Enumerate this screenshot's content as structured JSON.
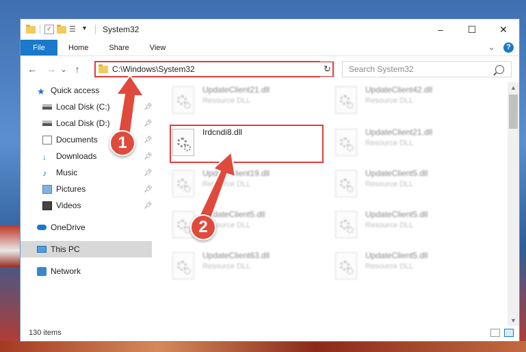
{
  "window": {
    "title": "System32",
    "controls": [
      "–",
      "☐",
      "✕"
    ]
  },
  "ribbon": {
    "tabs": [
      "File",
      "Home",
      "Share",
      "View"
    ],
    "expand_glyph": "⌄",
    "help_glyph": "?"
  },
  "nav": {
    "back": "←",
    "forward": "→",
    "recent": "⌄",
    "up": "↑",
    "address": "C:\\Windows\\System32",
    "address_drop": "⌄",
    "refresh": "↻",
    "search_placeholder": "Search System32"
  },
  "sidebar": {
    "items": [
      {
        "label": "Quick access",
        "icon": "star-icon",
        "pinned": false
      },
      {
        "label": "Local Disk (C:)",
        "icon": "disk-icon",
        "pinned": true
      },
      {
        "label": "Local Disk (D:)",
        "icon": "disk-icon",
        "pinned": true
      },
      {
        "label": "Documents",
        "icon": "documents-icon",
        "pinned": true
      },
      {
        "label": "Downloads",
        "icon": "downloads-icon",
        "pinned": true
      },
      {
        "label": "Music",
        "icon": "music-icon",
        "pinned": true
      },
      {
        "label": "Pictures",
        "icon": "pictures-icon",
        "pinned": true
      },
      {
        "label": "Videos",
        "icon": "videos-icon",
        "pinned": true
      },
      {
        "label": "OneDrive",
        "icon": "onedrive-icon",
        "pinned": false
      },
      {
        "label": "This PC",
        "icon": "this-pc-icon",
        "pinned": false,
        "selected": true
      },
      {
        "label": "Network",
        "icon": "network-icon",
        "pinned": false
      }
    ]
  },
  "files": {
    "left_column": [
      {
        "name": "UpdateClient21.dll",
        "type": "Resource DLL",
        "blurred": true
      },
      {
        "name": "Irdcndi8.dll",
        "type": "",
        "blurred": false,
        "highlighted": true
      },
      {
        "name": "UpdateClient19.dll",
        "type": "Resource DLL",
        "blurred": true
      },
      {
        "name": "UpdateClient5.dll",
        "type": "Resource DLL",
        "blurred": true
      },
      {
        "name": "UpdateClient63.dll",
        "type": "Resource DLL",
        "blurred": true
      }
    ],
    "right_column": [
      {
        "name": "UpdateClient42.dll",
        "type": "Resource DLL",
        "blurred": true
      },
      {
        "name": "UpdateClient21.dll",
        "type": "Resource DLL",
        "blurred": true
      },
      {
        "name": "UpdateClient5.dll",
        "type": "Resource DLL",
        "blurred": true
      },
      {
        "name": "UpdateClient5.dll",
        "type": "Resource DLL",
        "blurred": true
      },
      {
        "name": "UpdateClient5.dll",
        "type": "Resource DLL",
        "blurred": true
      }
    ]
  },
  "status": {
    "item_count": "130 items"
  },
  "annotations": {
    "step1": "1",
    "step2": "2",
    "color": "#e04a3c"
  }
}
